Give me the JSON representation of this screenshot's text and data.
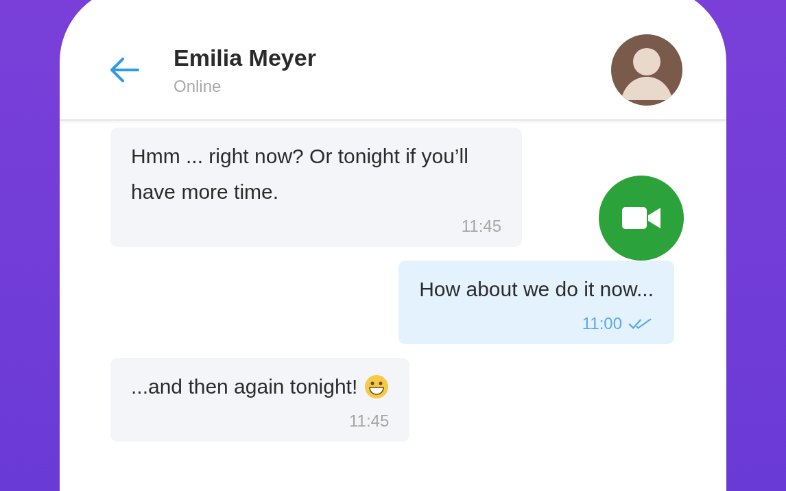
{
  "header": {
    "name": "Emilia Meyer",
    "status": "Online"
  },
  "messages": [
    {
      "kind": "incoming",
      "text": "Hmm ... right now? Or tonight if you’ll have more time.",
      "time": "11:45",
      "emoji": false
    },
    {
      "kind": "outgoing",
      "text": "How about we do it now...",
      "time": "11:00",
      "read": true
    },
    {
      "kind": "incoming",
      "text": "...and then again tonight!",
      "time": "11:45",
      "emoji": true
    }
  ]
}
